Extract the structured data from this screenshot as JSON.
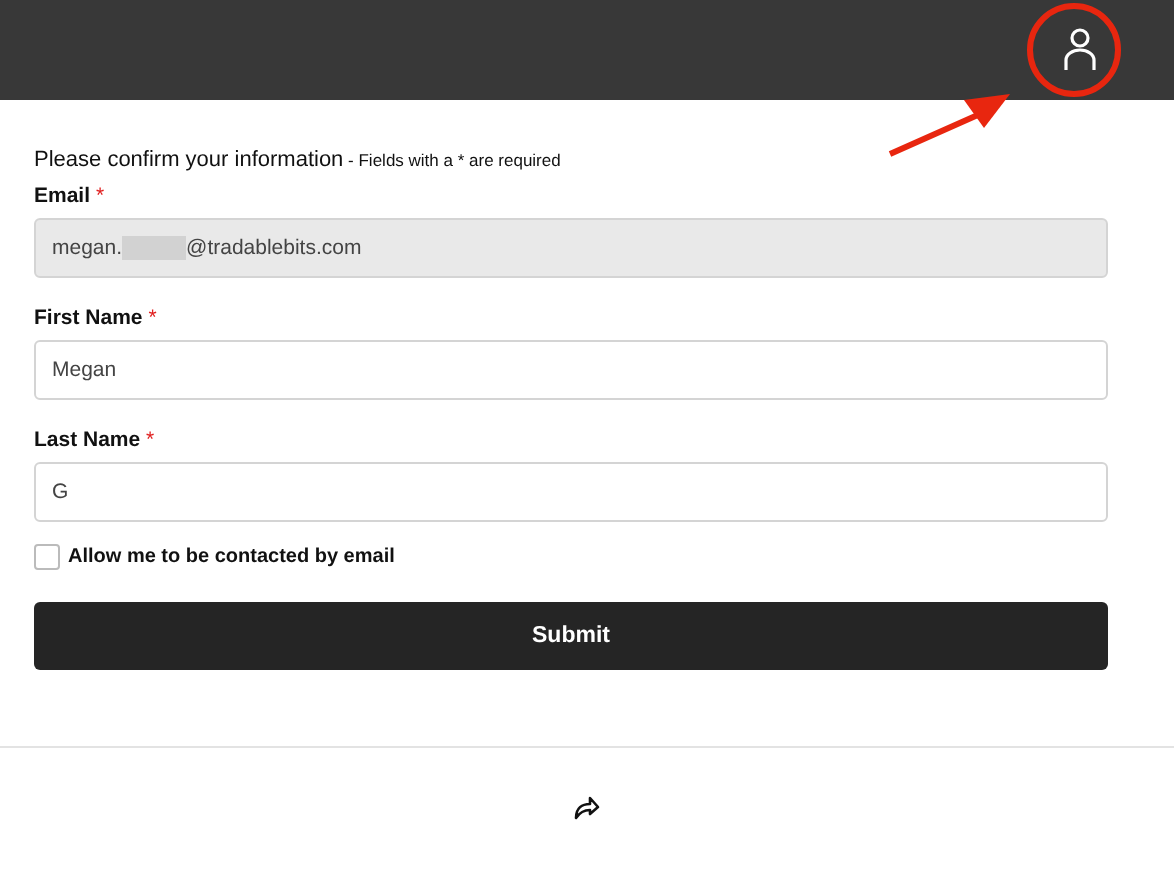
{
  "intro": {
    "title": "Please confirm your information",
    "note": " - Fields with a * are required"
  },
  "fields": [
    {
      "label": "Email",
      "required_mark": "*",
      "value_before": "megan.",
      "redacted": true,
      "value_after": "@tradablebits.com",
      "disabled": true
    },
    {
      "label": "First Name",
      "required_mark": "*",
      "value_before": "Megan",
      "redacted": false,
      "disabled": false
    },
    {
      "label": "Last Name",
      "required_mark": "*",
      "value_before": "G",
      "redacted": false,
      "disabled": false
    }
  ],
  "consent": {
    "label": "Allow me to be contacted by email",
    "checked": false
  },
  "submit": "Submit"
}
